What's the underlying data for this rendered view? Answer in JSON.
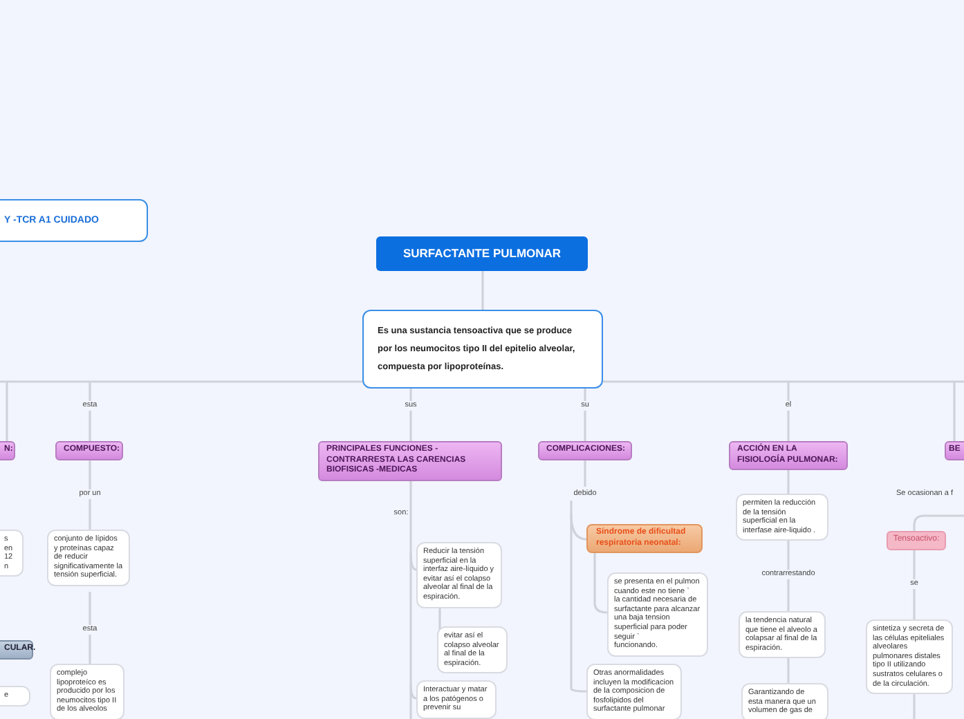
{
  "mind_map": {
    "nodes": [
      {
        "kind": "frame",
        "text": "Y -TCR A1 CUIDADO"
      },
      {
        "kind": "root",
        "text": "SURFACTANTE PULMONAR"
      },
      {
        "kind": "frame",
        "text": "Es una sustancia tensoactiva que se produce por los neumocitos tipo II del epitelio alveolar, compuesta por lipoproteínas."
      },
      {
        "kind": "topic",
        "text": "N:"
      },
      {
        "kind": "topic",
        "text": "COMPUESTO:"
      },
      {
        "kind": "topic",
        "text": "PRINCIPALES FUNCIONES - CONTRARRESTA LAS CARENCIAS BIOFISICAS -MEDICAS"
      },
      {
        "kind": "topic",
        "text": "COMPLICACIONES:"
      },
      {
        "kind": "topic",
        "text": "ACCIÓN EN LA FISIOLOGÍA PULMONAR:"
      },
      {
        "kind": "topic",
        "text": "BE"
      },
      {
        "kind": "note",
        "text": "s en\n12\nn"
      },
      {
        "kind": "note",
        "text": "conjunto de lípidos y proteínas capaz de reducir significativamente la tensión superficial."
      },
      {
        "kind": "slate",
        "text": "CULAR."
      },
      {
        "kind": "note",
        "text": "complejo lipoproteíco es producido por los neumocitos tipo II de los alveolos"
      },
      {
        "kind": "note",
        "text": "e"
      },
      {
        "kind": "note",
        "text": "Reducir la tensión superficial en la interfaz aire-líquido y evitar así el colapso alveolar al final de la espiración."
      },
      {
        "kind": "note",
        "text": "evitar así el colapso alveolar al final de la espiración."
      },
      {
        "kind": "note",
        "text": "Interactuar y matar a los patógenos o prevenir su"
      },
      {
        "kind": "alert",
        "text": "Síndrome de dificultad respiratoria neonatal:"
      },
      {
        "kind": "note",
        "text": "se presenta en el pulmon cuando este no tiene ˋ\nla cantidad necesaria de surfactante para alcanzar una baja tension superficial para poder seguir ˋ\nfuncionando."
      },
      {
        "kind": "note",
        "text": "Otras anormalidades incluyen la modificacion de la composicion de fosfolipidos del surfactante pulmonar"
      },
      {
        "kind": "note",
        "text": "permiten la reducción de la tensión superficial en la interfase aire-liquido ."
      },
      {
        "kind": "note",
        "text": "la tendencia natural que tiene el alveolo a colapsar al final de la espiración."
      },
      {
        "kind": "note",
        "text": "Garantizando de esta manera que un volumen de gas de"
      },
      {
        "kind": "pink",
        "text": "Tensoactivo:"
      },
      {
        "kind": "note",
        "text": "sintetiza y secreta de las células epiteliales alveolares pulmonares distales tipo II utilizando sustratos celulares o de la circulación."
      }
    ],
    "links": [
      {
        "text": "esta"
      },
      {
        "text": "sus"
      },
      {
        "text": "su"
      },
      {
        "text": "el"
      },
      {
        "text": "por un"
      },
      {
        "text": "esta"
      },
      {
        "text": "son:"
      },
      {
        "text": "debido"
      },
      {
        "text": "contrarrestando"
      },
      {
        "text": "Se ocasionan a f"
      },
      {
        "text": "se"
      }
    ]
  }
}
